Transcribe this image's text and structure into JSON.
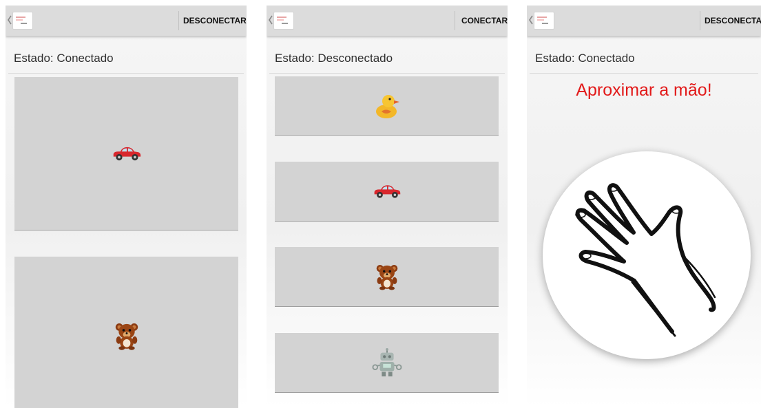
{
  "screens": [
    {
      "action_label": "DESCONECTAR",
      "status_text": "Estado: Conectado",
      "cards": [
        {
          "icon": "car-icon"
        },
        {
          "icon": "teddy-bear-icon"
        }
      ]
    },
    {
      "action_label": "CONECTAR",
      "status_text": "Estado: Desconectado",
      "cards": [
        {
          "icon": "duck-icon"
        },
        {
          "icon": "car-icon"
        },
        {
          "icon": "teddy-bear-icon"
        },
        {
          "icon": "robot-icon"
        }
      ]
    },
    {
      "action_label": "DESCONECTAR",
      "status_text": "Estado: Conectado",
      "prompt": "Aproximar a mão!",
      "center_icon": "hand-icon"
    }
  ],
  "colors": {
    "appbar": "#dcdcdc",
    "card": "#d3d3d3",
    "prompt": "#e21a1a"
  }
}
